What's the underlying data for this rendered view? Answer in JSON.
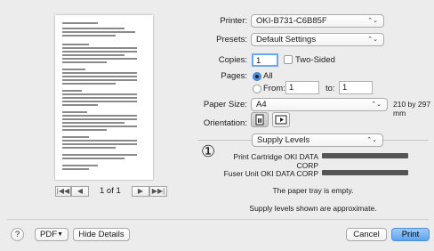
{
  "printer": {
    "label": "Printer:",
    "value": "OKI-B731-C6B85F"
  },
  "presets": {
    "label": "Presets:",
    "value": "Default Settings"
  },
  "copies": {
    "label": "Copies:",
    "value": "1",
    "two_sided": "Two-Sided"
  },
  "pages": {
    "label": "Pages:",
    "all": "All",
    "from": "From:",
    "from_value": "1",
    "to": "to:",
    "to_value": "1"
  },
  "paper_size": {
    "label": "Paper Size:",
    "value": "A4",
    "dims": "210 by 297 mm"
  },
  "orientation": {
    "label": "Orientation:"
  },
  "section": {
    "value": "Supply Levels"
  },
  "annotation": {
    "marker": "①"
  },
  "supplies": {
    "items": [
      {
        "label": "Print Cartridge OKI DATA CORP",
        "level": 1.0
      },
      {
        "label": "Fuser Unit OKI DATA CORP",
        "level": 1.0
      }
    ],
    "tray_message": "The paper tray is empty.",
    "note": "Supply levels shown are approximate."
  },
  "pager": {
    "first": "|◀◀",
    "prev": "◀",
    "page": "1 of 1",
    "next": "▶",
    "last": "▶▶|"
  },
  "footer": {
    "help": "?",
    "pdf": "PDF",
    "hide_details": "Hide Details",
    "cancel": "Cancel",
    "print": "Print"
  },
  "colors": {
    "accent": "#6aa9ef",
    "window_bg": "#ececec"
  }
}
